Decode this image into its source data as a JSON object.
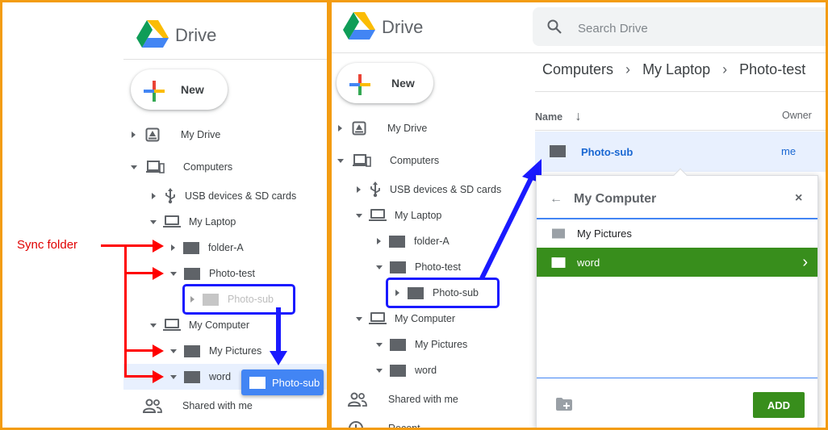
{
  "left": {
    "logo_text": "Drive",
    "new_label": "New",
    "nav": {
      "my_drive": "My Drive",
      "computers": "Computers",
      "usb": "USB devices & SD cards",
      "my_laptop": "My Laptop",
      "folder_a": "folder-A",
      "photo_test": "Photo-test",
      "photo_sub_ghost": "Photo-sub",
      "my_computer": "My Computer",
      "my_pictures": "My Pictures",
      "word": "word",
      "shared": "Shared with me"
    },
    "annotation": "Sync folder",
    "drag_chip": "Photo-sub"
  },
  "right": {
    "logo_text": "Drive",
    "search_placeholder": "Search Drive",
    "new_label": "New",
    "breadcrumb": [
      "Computers",
      "My Laptop",
      "Photo-test"
    ],
    "columns": {
      "name": "Name",
      "owner": "Owner"
    },
    "file_row": {
      "name": "Photo-sub",
      "owner": "me"
    },
    "nav": {
      "my_drive": "My Drive",
      "computers": "Computers",
      "usb": "USB devices & SD cards",
      "my_laptop": "My Laptop",
      "folder_a": "folder-A",
      "photo_test": "Photo-test",
      "photo_sub": "Photo-sub",
      "my_computer": "My Computer",
      "my_pictures": "My Pictures",
      "word": "word",
      "shared": "Shared with me",
      "recent_partial": "Recent"
    },
    "dialog": {
      "title": "My Computer",
      "items": [
        "My Pictures",
        "word"
      ],
      "selected": "word",
      "add_label": "ADD"
    }
  },
  "colors": {
    "frame": "#f39c12",
    "highlight_box": "#1a1aff",
    "annotation_red": "#ff0000",
    "selected_green": "#388e1c",
    "drag_blue": "#4285f4",
    "row_selected": "#e8f0fe"
  }
}
